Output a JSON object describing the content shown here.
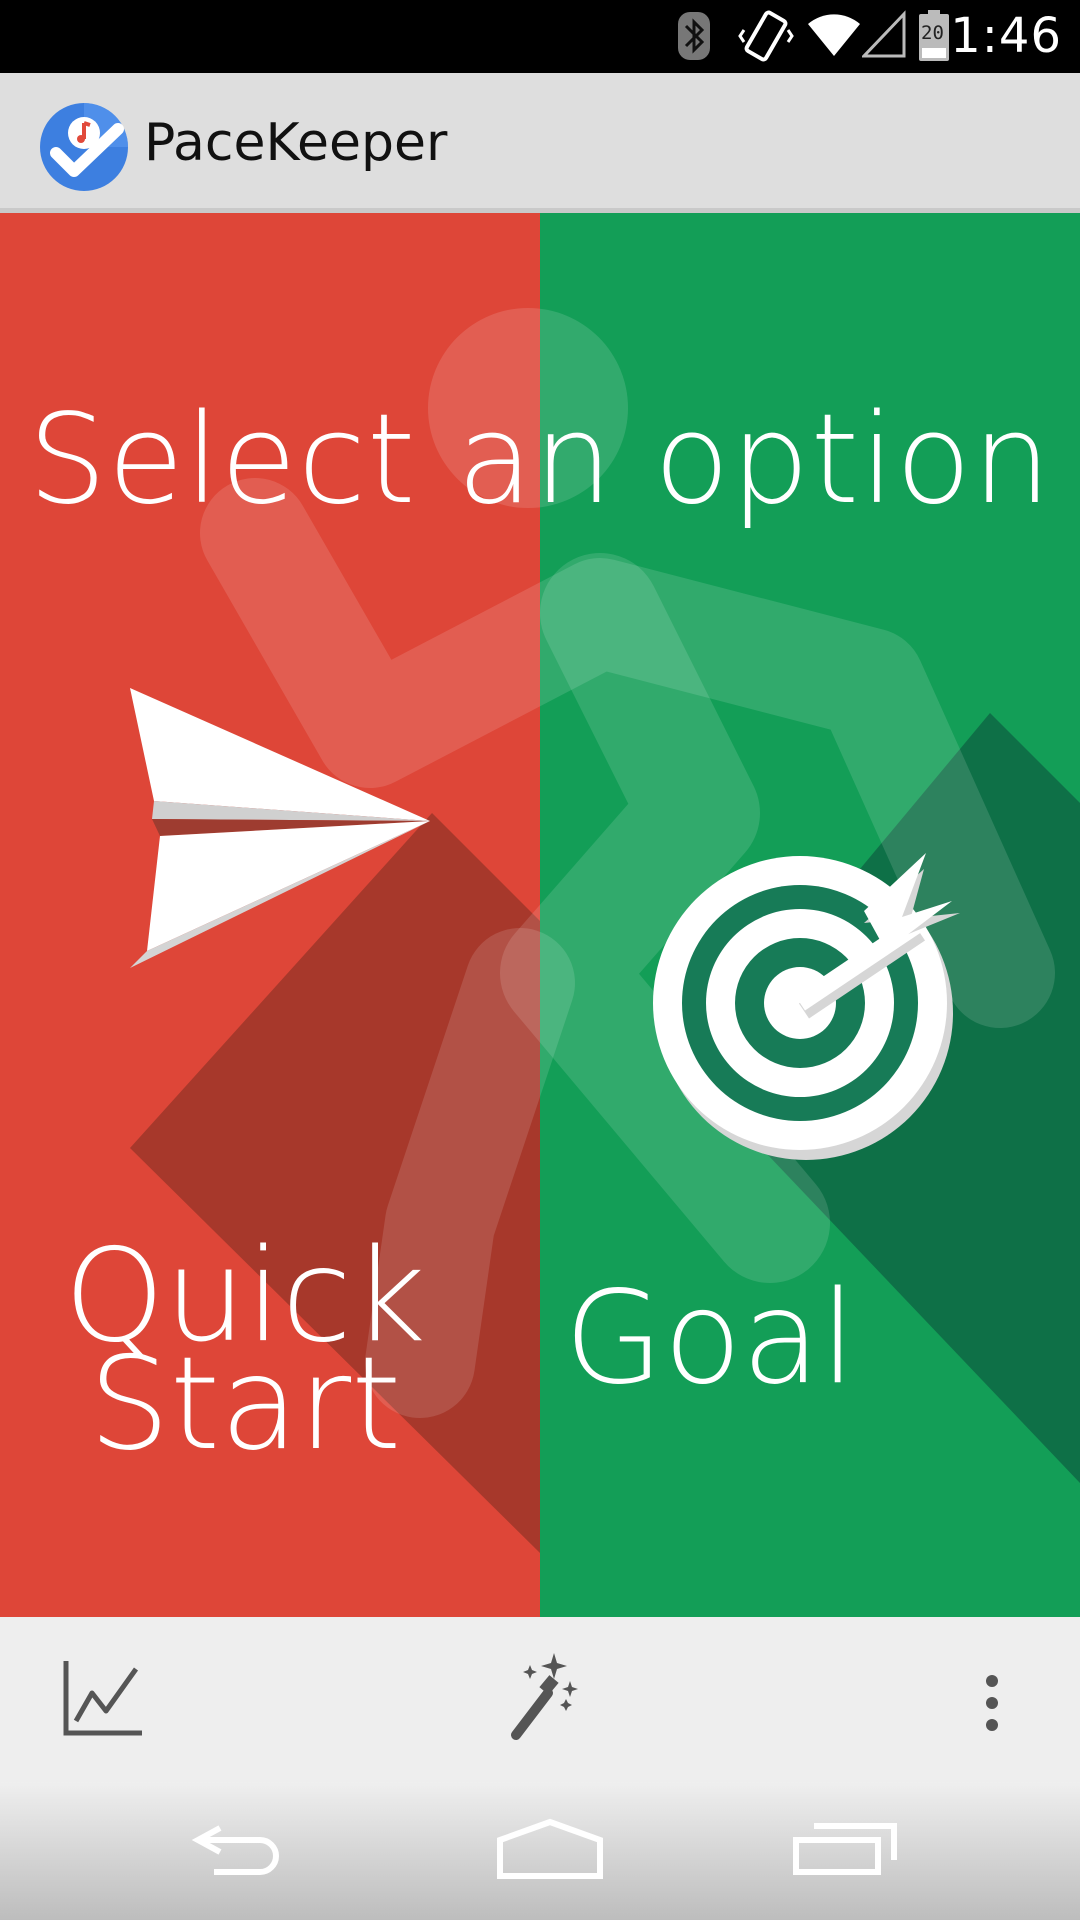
{
  "status_bar": {
    "time": "1:46",
    "battery_level": "20",
    "icons": [
      "bluetooth-icon",
      "vibrate-icon",
      "wifi-icon",
      "cell-signal-icon",
      "battery-icon"
    ]
  },
  "app": {
    "title": "PaceKeeper",
    "logo_icon": "pacekeeper-logo-icon"
  },
  "main": {
    "heading": "Select an option",
    "left_color": "#de4638",
    "right_color": "#139e57",
    "options": [
      {
        "label_line1": "Quick",
        "label_line2": "Start",
        "icon": "paper-plane-icon"
      },
      {
        "label": "Goal",
        "icon": "target-arrow-icon"
      }
    ]
  },
  "toolbar": {
    "items": [
      {
        "icon": "chart-line-icon"
      },
      {
        "icon": "magic-wand-icon"
      },
      {
        "icon": "more-vert-icon"
      }
    ]
  },
  "nav_bar": {
    "items": [
      {
        "icon": "back-icon"
      },
      {
        "icon": "home-icon"
      },
      {
        "icon": "recents-icon"
      }
    ]
  }
}
